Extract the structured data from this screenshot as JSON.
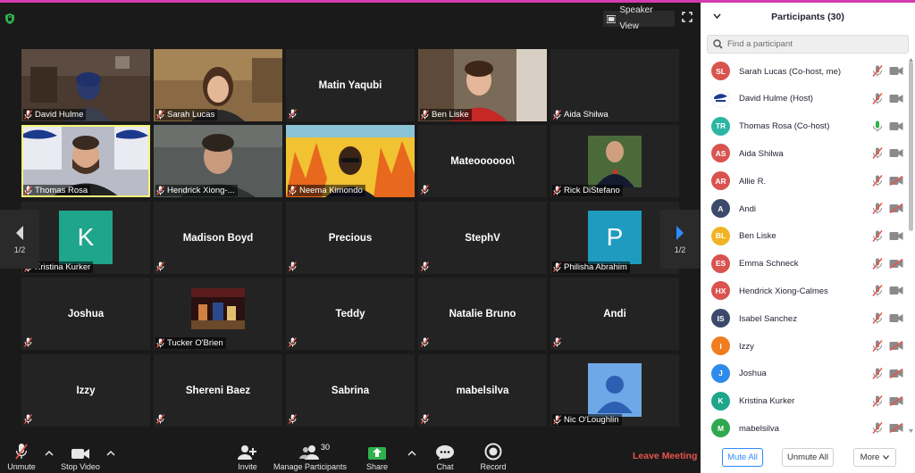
{
  "meeting": {
    "view_label": "Speaker View",
    "pager_left": "1/2",
    "pager_right": "1/2"
  },
  "tiles": [
    {
      "name": "David Hulme",
      "type": "photo"
    },
    {
      "name": "Sarah Lucas",
      "type": "photo"
    },
    {
      "name": "Matin Yaqubi",
      "type": "name"
    },
    {
      "name": "Ben Liske",
      "type": "photo"
    },
    {
      "name": "Aida Shilwa",
      "type": "label"
    },
    {
      "name": "Thomas Rosa",
      "type": "photo"
    },
    {
      "name": "Hendrick Xiong-...",
      "type": "photo"
    },
    {
      "name": "Neema Kimondo",
      "type": "photo"
    },
    {
      "name": "Mateoooooo\\",
      "type": "name"
    },
    {
      "name": "Rick DiStefano",
      "type": "photo"
    },
    {
      "name": "Kristina Kurker",
      "type": "avatar",
      "initial": "K"
    },
    {
      "name": "Madison Boyd",
      "type": "name"
    },
    {
      "name": "Precious",
      "type": "name"
    },
    {
      "name": "StephV",
      "type": "name"
    },
    {
      "name": "Philisha Abrahim",
      "type": "avatar",
      "initial": "P"
    },
    {
      "name": "Joshua",
      "type": "name"
    },
    {
      "name": "Tucker O'Brien",
      "type": "photo"
    },
    {
      "name": "Teddy",
      "type": "name"
    },
    {
      "name": "Natalie Bruno",
      "type": "name"
    },
    {
      "name": "Andi",
      "type": "name"
    },
    {
      "name": "Izzy",
      "type": "name"
    },
    {
      "name": "Shereni Baez",
      "type": "name"
    },
    {
      "name": "Sabrina",
      "type": "name"
    },
    {
      "name": "mabelsilva",
      "type": "name"
    },
    {
      "name": "Nic O'Loughlin",
      "type": "avatar-person"
    }
  ],
  "toolbar": {
    "unmute": "Unmute",
    "stop_video": "Stop Video",
    "invite": "Invite",
    "manage_participants": "Manage Participants",
    "participant_count": "30",
    "share": "Share",
    "chat": "Chat",
    "record": "Record",
    "leave": "Leave Meeting"
  },
  "panel": {
    "title": "Participants (30)",
    "search_placeholder": "Find a participant",
    "mute_all": "Mute All",
    "unmute_all": "Unmute All",
    "more": "More",
    "participants": [
      {
        "initials": "SL",
        "name": "Sarah Lucas (Co-host, me)",
        "color": "#d9534f",
        "mic": "muted-red",
        "cam": "on"
      },
      {
        "initials": "",
        "name": "David Hulme (Host)",
        "color": "#ffffff",
        "mic": "muted-red",
        "cam": "on"
      },
      {
        "initials": "TR",
        "name": "Thomas Rosa (Co-host)",
        "color": "#2bb5a5",
        "mic": "active",
        "cam": "on"
      },
      {
        "initials": "AS",
        "name": "Aida Shilwa",
        "color": "#d9534f",
        "mic": "muted-red",
        "cam": "on"
      },
      {
        "initials": "AR",
        "name": "Allie R.",
        "color": "#d9534f",
        "mic": "muted-red",
        "cam": "off"
      },
      {
        "initials": "A",
        "name": "Andi",
        "color": "#3b4a6b",
        "mic": "muted-red",
        "cam": "off"
      },
      {
        "initials": "BL",
        "name": "Ben Liske",
        "color": "#f0b323",
        "mic": "muted-red",
        "cam": "on"
      },
      {
        "initials": "ES",
        "name": "Emma Schneck",
        "color": "#d9534f",
        "mic": "muted-red",
        "cam": "off"
      },
      {
        "initials": "HX",
        "name": "Hendrick Xiong-Calmes",
        "color": "#d9534f",
        "mic": "muted-red",
        "cam": "on"
      },
      {
        "initials": "IS",
        "name": "Isabel Sanchez",
        "color": "#3b4a6b",
        "mic": "muted-red",
        "cam": "on"
      },
      {
        "initials": "I",
        "name": "Izzy",
        "color": "#f07d1e",
        "mic": "muted-red",
        "cam": "off"
      },
      {
        "initials": "J",
        "name": "Joshua",
        "color": "#2d8ceb",
        "mic": "muted-red",
        "cam": "off"
      },
      {
        "initials": "K",
        "name": "Kristina Kurker",
        "color": "#1fa58c",
        "mic": "muted-red",
        "cam": "off"
      },
      {
        "initials": "M",
        "name": "mabelsilva",
        "color": "#2fa84f",
        "mic": "muted-red",
        "cam": "off"
      }
    ]
  }
}
